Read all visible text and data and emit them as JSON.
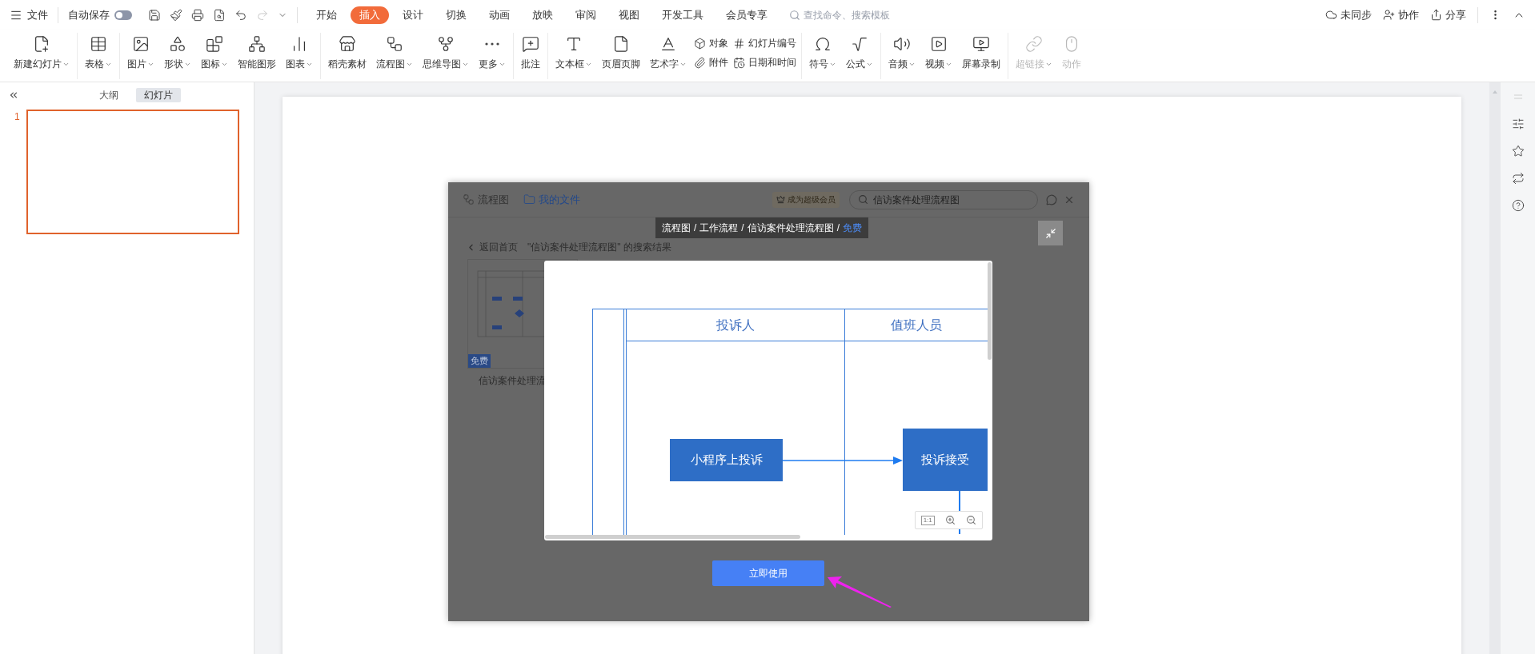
{
  "menu_bar": {
    "file": "文件",
    "autosave": {
      "label": "自动保存",
      "on": false
    },
    "quick_tools": [
      {
        "disabled": false
      },
      {
        "disabled": false
      },
      {
        "disabled": false
      },
      {
        "disabled": false
      },
      {
        "disabled": false
      },
      {
        "disabled": true
      },
      {
        "disabled": false
      }
    ],
    "tabs": [
      {
        "label": "开始",
        "selected": false
      },
      {
        "label": "插入",
        "selected": true
      },
      {
        "label": "设计",
        "selected": false
      },
      {
        "label": "切换",
        "selected": false
      },
      {
        "label": "动画",
        "selected": false
      },
      {
        "label": "放映",
        "selected": false
      },
      {
        "label": "审阅",
        "selected": false
      },
      {
        "label": "视图",
        "selected": false
      },
      {
        "label": "开发工具",
        "selected": false
      },
      {
        "label": "会员专享",
        "selected": false
      }
    ],
    "search": {
      "placeholder": "查找命令、搜索模板"
    },
    "actions": [
      "未同步",
      "协作",
      "分享"
    ]
  },
  "ribbon": {
    "groups": [
      {
        "items": [
          {
            "kind": "large",
            "label": "新建幻灯片",
            "dropdown": true,
            "disabled": false
          }
        ]
      },
      {
        "items": [
          {
            "kind": "large",
            "label": "表格",
            "dropdown": true,
            "disabled": false
          }
        ]
      },
      {
        "items": [
          {
            "kind": "large",
            "label": "图片",
            "dropdown": true,
            "disabled": false
          },
          {
            "kind": "large",
            "label": "形状",
            "dropdown": true,
            "disabled": false
          },
          {
            "kind": "large",
            "label": "图标",
            "dropdown": true,
            "disabled": false
          },
          {
            "kind": "large",
            "label": "智能图形",
            "dropdown": false,
            "disabled": false
          },
          {
            "kind": "large",
            "label": "图表",
            "dropdown": true,
            "disabled": false
          }
        ]
      },
      {
        "items": [
          {
            "kind": "large",
            "label": "稻壳素材",
            "dropdown": false,
            "disabled": false
          },
          {
            "kind": "large",
            "label": "流程图",
            "dropdown": true,
            "disabled": false
          },
          {
            "kind": "large",
            "label": "思维导图",
            "dropdown": true,
            "disabled": false
          },
          {
            "kind": "large",
            "label": "更多",
            "dropdown": true,
            "disabled": false
          }
        ]
      },
      {
        "items": [
          {
            "kind": "large",
            "label": "批注",
            "dropdown": false,
            "disabled": false
          }
        ]
      },
      {
        "items": [
          {
            "kind": "large",
            "label": "文本框",
            "dropdown": true,
            "disabled": false
          },
          {
            "kind": "large",
            "label": "页眉页脚",
            "dropdown": false,
            "disabled": false
          },
          {
            "kind": "large",
            "label": "艺术字",
            "dropdown": true,
            "disabled": false
          },
          {
            "kind": "stack",
            "items": [
              {
                "label": "对象"
              },
              {
                "label": "附件"
              }
            ]
          },
          {
            "kind": "stack",
            "items": [
              {
                "label": "幻灯片编号"
              },
              {
                "label": "日期和时间"
              }
            ]
          }
        ]
      },
      {
        "items": [
          {
            "kind": "large",
            "label": "符号",
            "dropdown": true,
            "disabled": false
          },
          {
            "kind": "large",
            "label": "公式",
            "dropdown": true,
            "disabled": false
          }
        ]
      },
      {
        "items": [
          {
            "kind": "large",
            "label": "音频",
            "dropdown": true,
            "disabled": false
          },
          {
            "kind": "large",
            "label": "视频",
            "dropdown": true,
            "disabled": false
          },
          {
            "kind": "large",
            "label": "屏幕录制",
            "dropdown": false,
            "disabled": false
          }
        ]
      },
      {
        "items": [
          {
            "kind": "large",
            "label": "超链接",
            "dropdown": true,
            "disabled": true
          },
          {
            "kind": "large",
            "label": "动作",
            "dropdown": false,
            "disabled": true
          }
        ]
      }
    ]
  },
  "left_pane": {
    "tabs": [
      {
        "label": "大纲",
        "selected": false
      },
      {
        "label": "幻灯片",
        "selected": true
      }
    ],
    "slides": [
      {
        "number": "1",
        "selected": true
      }
    ]
  },
  "dialog": {
    "header": {
      "title": "流程图",
      "my_files": "我的文件",
      "vip_badge": "成为超级会员",
      "search": {
        "value": "信访案件处理流程图"
      }
    },
    "breadcrumb": [
      {
        "kind": "crumb",
        "label": "流程图"
      },
      {
        "kind": "separator",
        "label": "/"
      },
      {
        "kind": "crumb",
        "label": "工作流程"
      },
      {
        "kind": "separator",
        "label": "/"
      },
      {
        "kind": "crumb",
        "label": "信访案件处理流程图"
      },
      {
        "kind": "separator",
        "label": "/"
      },
      {
        "kind": "tag",
        "label": "免费"
      }
    ],
    "back_link": "返回首页",
    "results_title": "\"信访案件处理流程图\" 的搜索结果",
    "results": [
      {
        "tag": "免费",
        "title": "信访案件处理流"
      }
    ],
    "preview": {
      "lanes": [
        "投诉人",
        "值班人员"
      ],
      "nodes": [
        "小程序上投诉",
        "投诉接受"
      ],
      "zoom_reset": "1:1"
    },
    "use_button": "立即使用"
  }
}
